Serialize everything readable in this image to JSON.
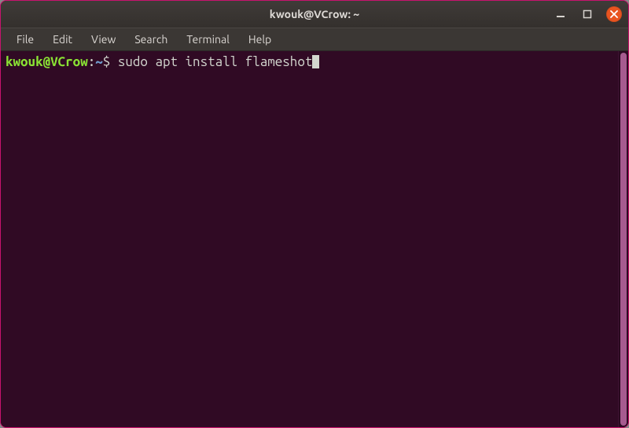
{
  "window": {
    "title": "kwouk@VCrow: ~"
  },
  "menubar": {
    "items": [
      "File",
      "Edit",
      "View",
      "Search",
      "Terminal",
      "Help"
    ]
  },
  "prompt": {
    "user_host": "kwouk@VCrow",
    "separator": ":",
    "path": "~",
    "sigil": "$ ",
    "command": "sudo apt install flameshot"
  },
  "colors": {
    "bg": "#300a24",
    "accent": "#e95420",
    "prompt_green": "#8ae234",
    "prompt_blue": "#729fcf",
    "text": "#d3d7cf"
  }
}
